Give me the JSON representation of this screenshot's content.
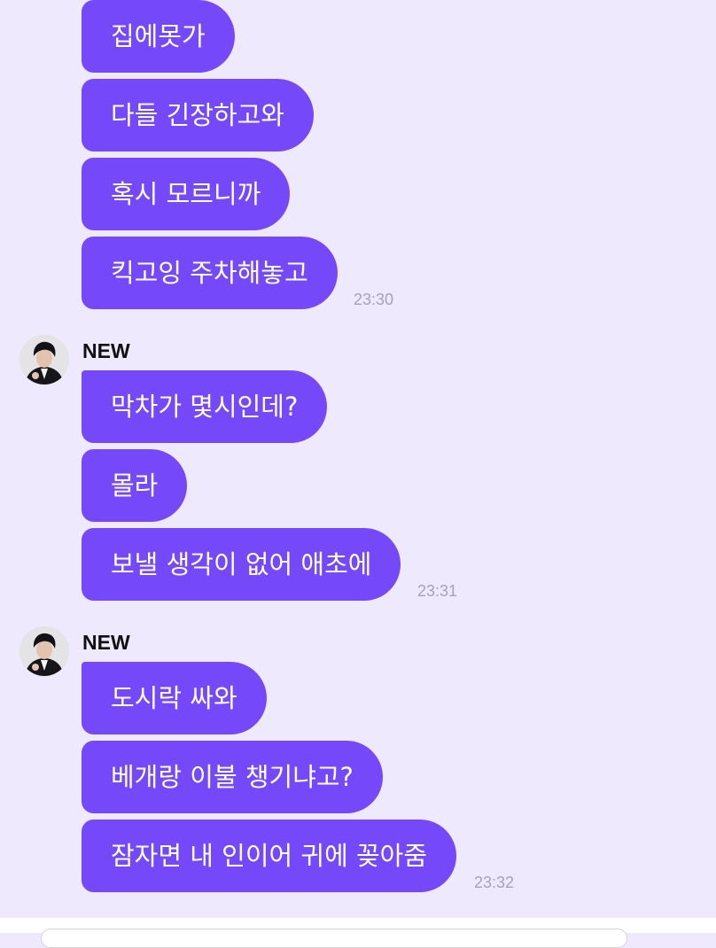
{
  "chat": {
    "groups": [
      {
        "sender": "",
        "messages": [
          "집에못가",
          "다들 긴장하고와",
          "혹시 모르니까",
          "킥고잉 주차해놓고"
        ],
        "time": "23:30"
      },
      {
        "sender": "NEW",
        "messages": [
          "막차가 몇시인데?",
          "몰라",
          "보낼 생각이 없어 애초에"
        ],
        "time": "23:31"
      },
      {
        "sender": "NEW",
        "messages": [
          "도시락 싸와",
          "베개랑 이불 챙기냐고?",
          "잠자면 내 인이어 귀에 꽂아줌"
        ],
        "time": "23:32"
      }
    ]
  },
  "colors": {
    "background": "#EEE9FC",
    "bubble": "#7548FA",
    "bubble_text": "#FFFFFF",
    "timestamp": "#A7A3B3"
  },
  "icons": {
    "avatar": "profile-photo-avatar"
  }
}
